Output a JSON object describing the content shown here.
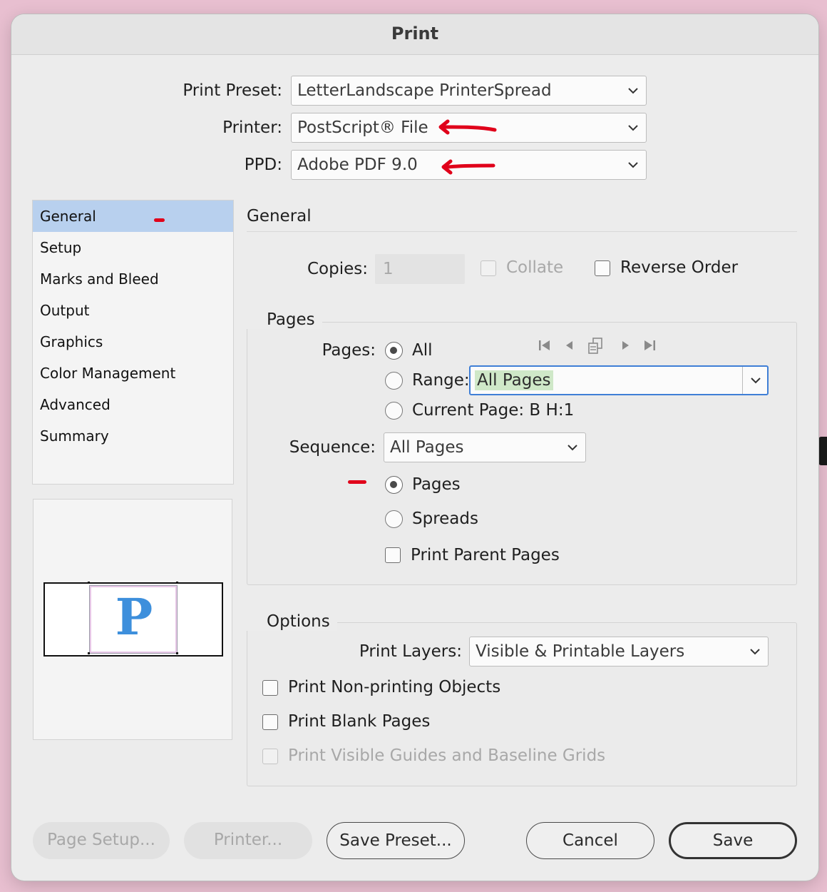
{
  "window": {
    "title": "Print"
  },
  "top_fields": {
    "preset_label": "Print Preset:",
    "preset_value": "LetterLandscape PrinterSpread",
    "printer_label": "Printer:",
    "printer_value": "PostScript® File",
    "ppd_label": "PPD:",
    "ppd_value": "Adobe PDF 9.0"
  },
  "sidebar": {
    "items": [
      {
        "label": "General",
        "selected": true
      },
      {
        "label": "Setup"
      },
      {
        "label": "Marks and Bleed"
      },
      {
        "label": "Output"
      },
      {
        "label": "Graphics"
      },
      {
        "label": "Color Management"
      },
      {
        "label": "Advanced"
      },
      {
        "label": "Summary"
      }
    ]
  },
  "preview": {
    "letter": "P"
  },
  "general": {
    "heading": "General",
    "copies_label": "Copies:",
    "copies_value": "1",
    "collate_label": "Collate",
    "reverse_label": "Reverse Order"
  },
  "pages_group": {
    "title": "Pages",
    "pages_label": "Pages:",
    "all_label": "All",
    "range_label": "Range:",
    "range_value": "All Pages",
    "current_label": "Current Page: B H:1",
    "sequence_label": "Sequence:",
    "sequence_value": "All Pages",
    "pages_option": "Pages",
    "spreads_option": "Spreads",
    "parent_label": "Print Parent Pages",
    "selected_mode": "All",
    "selected_layout": "Pages"
  },
  "options_group": {
    "title": "Options",
    "layers_label": "Print Layers:",
    "layers_value": "Visible & Printable Layers",
    "nonprinting_label": "Print Non-printing Objects",
    "blank_label": "Print Blank Pages",
    "guides_label": "Print Visible Guides and Baseline Grids"
  },
  "buttons": {
    "page_setup": "Page Setup...",
    "printer": "Printer...",
    "save_preset": "Save Preset...",
    "cancel": "Cancel",
    "save": "Save"
  },
  "colors": {
    "selection": "#b8d0ee",
    "annotation": "#e0001a",
    "range_highlight": "#cfe8c8",
    "focus_ring": "#3f7fd6",
    "preview_letter": "#3d8fdc"
  }
}
